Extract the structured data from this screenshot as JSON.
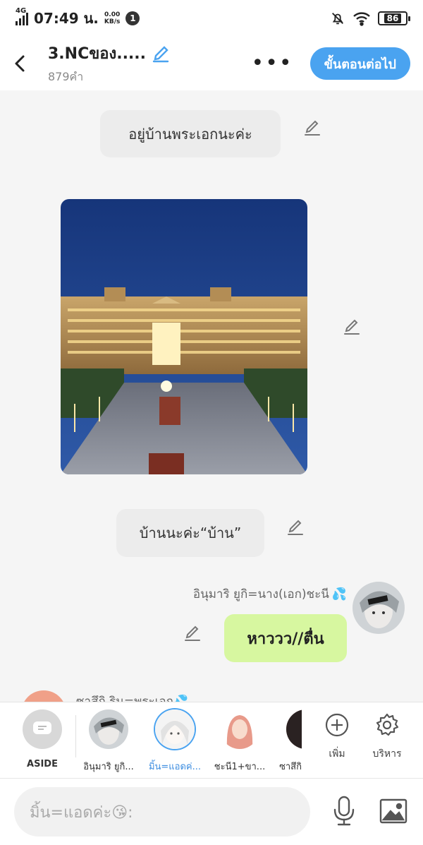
{
  "status_bar": {
    "network": "4G",
    "time": "07:49 น.",
    "speed_value": "0.00",
    "speed_unit": "KB/s",
    "notification_count": "1",
    "battery": "86"
  },
  "header": {
    "title": "3.NCของ.....",
    "word_count": "879คำ",
    "more_label": "•••",
    "next_button": "ขั้นตอนต่อไป"
  },
  "messages": {
    "narration_1": "อยู่บ้านพระเอกนะค่ะ",
    "narration_2": "บ้านนะค่ะ“บ้าน”",
    "speaker_1": "อินุมาริ ยูกิ=นาง(เอก)ชะนี",
    "speaker_1_emoji": "💦",
    "bubble_1": "หาววว//ตื่น",
    "partial_speaker": "ซาสึกิ ริน=พระเอก",
    "partial_speaker_emoji": "💦"
  },
  "characters": [
    {
      "label": "ASIDE",
      "icon": "aside-icon"
    },
    {
      "label": "อินุมาริ ยูกิ..."
    },
    {
      "label": "มิ้น=แอดค่...",
      "active": true
    },
    {
      "label": "ชะนี1+ขา..."
    },
    {
      "label": "ซาสึกิ"
    }
  ],
  "tools": {
    "add_label": "เพิ่ม",
    "manage_label": "บริหาร"
  },
  "input": {
    "placeholder": "มิ้น=แอดค่ะ😘:"
  },
  "colors": {
    "accent": "#4aa3f0",
    "green_bubble": "#d7f7a0",
    "gray_bubble": "#ececec"
  }
}
